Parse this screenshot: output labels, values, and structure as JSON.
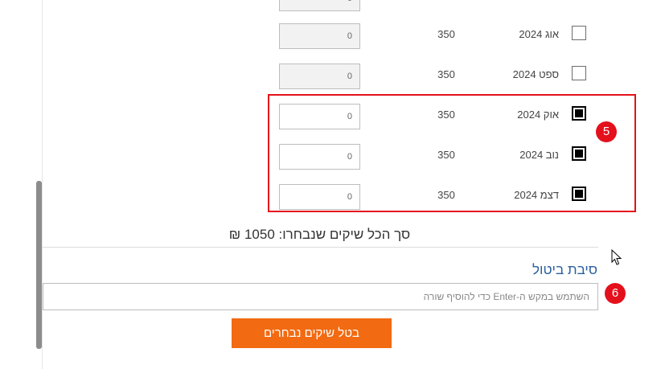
{
  "months": [
    {
      "label": "",
      "price": "",
      "amount": "0",
      "checked": false,
      "partial": true
    },
    {
      "label": "אוג 2024",
      "price": "350",
      "amount": "0",
      "checked": false
    },
    {
      "label": "ספט 2024",
      "price": "350",
      "amount": "0",
      "checked": false
    },
    {
      "label": "אוק 2024",
      "price": "350",
      "amount": "0",
      "checked": true
    },
    {
      "label": "נוב 2024",
      "price": "350",
      "amount": "0",
      "checked": true
    },
    {
      "label": "דצמ 2024",
      "price": "350",
      "amount": "0",
      "checked": true
    }
  ],
  "annotations": {
    "step5": "5",
    "step6": "6"
  },
  "total_text": "סך הכל שיקים שנבחרו: 1050 ₪",
  "cancel_reason": {
    "label": "סיבת ביטול",
    "placeholder": "השתמש במקש ה-Enter כדי להוסיף שורה",
    "value": ""
  },
  "submit_label": "בטל שיקים נבחרים",
  "colors": {
    "accent": "#f26a12",
    "annotation": "#e4101c",
    "link": "#2b5f9e"
  }
}
